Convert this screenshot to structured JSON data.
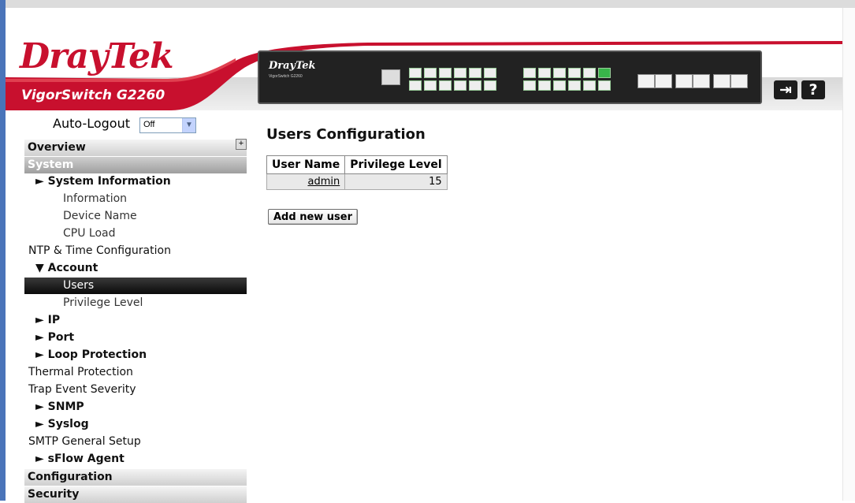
{
  "header": {
    "logo": "DrayTek",
    "product": "VigorSwitch G2260",
    "panel_brand": "DrayTek",
    "panel_model": "VigorSwitch G2260",
    "logout_icon": "logout-icon",
    "help_icon": "?"
  },
  "sidebar": {
    "autologout_label": "Auto-Logout",
    "autologout_value": "Off",
    "categories": {
      "overview": "Overview",
      "system": "System",
      "configuration": "Configuration",
      "security": "Security"
    },
    "items": [
      {
        "label": "► System Information",
        "kind": "group"
      },
      {
        "label": "Information",
        "kind": "sub"
      },
      {
        "label": "Device Name",
        "kind": "sub"
      },
      {
        "label": "CPU Load",
        "kind": "sub"
      },
      {
        "label": "NTP & Time Configuration",
        "kind": "item"
      },
      {
        "label": "▼ Account",
        "kind": "group"
      },
      {
        "label": "Users",
        "kind": "selected"
      },
      {
        "label": "Privilege Level",
        "kind": "sub"
      },
      {
        "label": "► IP",
        "kind": "group"
      },
      {
        "label": "► Port",
        "kind": "group"
      },
      {
        "label": "► Loop Protection",
        "kind": "group"
      },
      {
        "label": "Thermal Protection",
        "kind": "item"
      },
      {
        "label": "Trap Event Severity",
        "kind": "item"
      },
      {
        "label": "► SNMP",
        "kind": "group"
      },
      {
        "label": "► Syslog",
        "kind": "group"
      },
      {
        "label": "SMTP General Setup",
        "kind": "item"
      },
      {
        "label": "► sFlow Agent",
        "kind": "group"
      }
    ]
  },
  "main": {
    "title": "Users Configuration",
    "table": {
      "headers": [
        "User Name",
        "Privilege Level"
      ],
      "rows": [
        [
          "admin",
          "15"
        ]
      ]
    },
    "add_button": "Add new user"
  },
  "colors": {
    "brand_red": "#c8102e",
    "frame_blue": "#4a74b9",
    "selected_bg": "#111111"
  }
}
